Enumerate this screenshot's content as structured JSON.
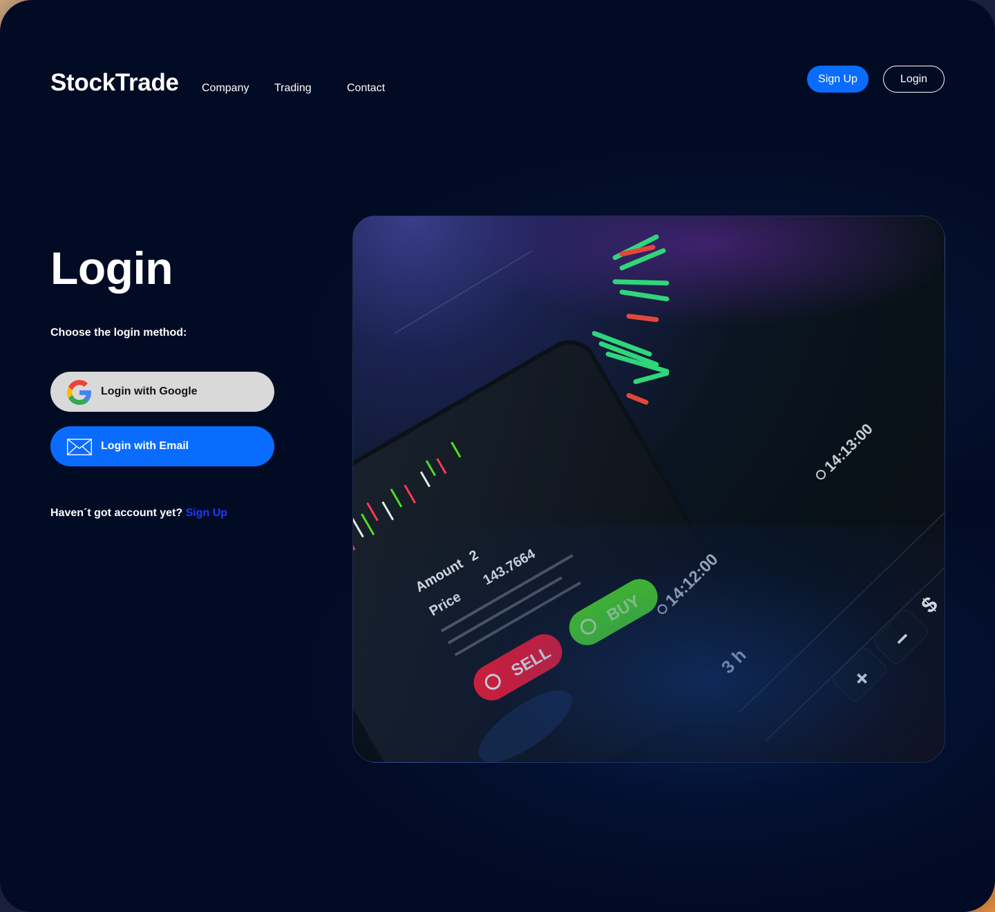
{
  "header": {
    "logo": "StockTrade",
    "nav": [
      "Company",
      "Trading",
      "Contact"
    ],
    "signup_label": "Sign Up",
    "login_label": "Login"
  },
  "main": {
    "title": "Login",
    "subtitle": "Choose the login method:",
    "google_label": "Login with Google",
    "email_label": "Login with Email",
    "no_account_text": "Haven´t got account yet?",
    "signup_link": "Sign Up"
  },
  "hero": {
    "sell_label": "SELL",
    "buy_label": "BUY",
    "amount_label": "Amount",
    "amount_value": "2",
    "price_label": "Price",
    "price_value": "143.7664",
    "time_1": "14:12:00",
    "time_2": "14:13:00",
    "interval": "3 h",
    "plus": "+",
    "minus": "−",
    "currency": "$"
  },
  "colors": {
    "background": "#020b24",
    "accent": "#0a6cff",
    "link": "#1a3cff",
    "google_button": "#d9d9d9",
    "sell": "#ff2a3d",
    "buy": "#4ee21e"
  }
}
